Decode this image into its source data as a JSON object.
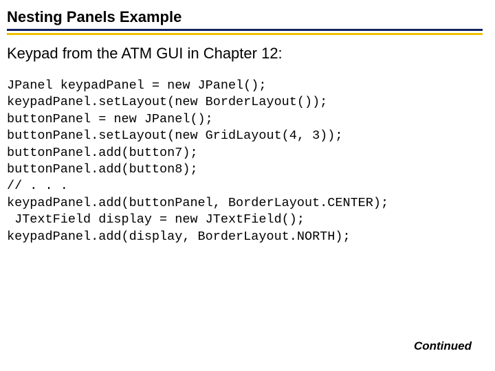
{
  "title": "Nesting Panels Example",
  "subtitle": "Keypad from the ATM GUI in Chapter 12:",
  "code": "JPanel keypadPanel = new JPanel();\nkeypadPanel.setLayout(new BorderLayout());\nbuttonPanel = new JPanel();\nbuttonPanel.setLayout(new GridLayout(4, 3));\nbuttonPanel.add(button7);\nbuttonPanel.add(button8);\n// . . .\nkeypadPanel.add(buttonPanel, BorderLayout.CENTER);\n JTextField display = new JTextField();\nkeypadPanel.add(display, BorderLayout.NORTH);",
  "footer": "Continued"
}
